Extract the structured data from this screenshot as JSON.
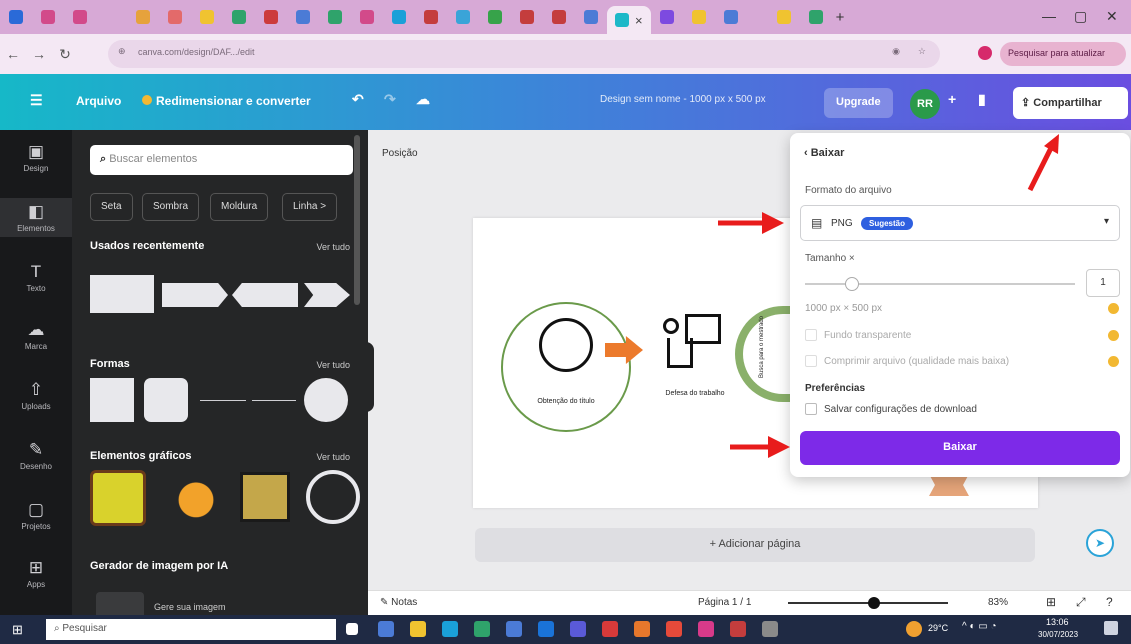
{
  "browser": {
    "url": "canva.com/design/DAF.../edit",
    "pause_button": "Pesquisar para atualizar",
    "close_tab": "×",
    "new_tab": "+"
  },
  "header": {
    "menu_icon": "☰",
    "file_label": "Arquivo",
    "resize_label": "Redimensionar e converter",
    "doc_title": "Design sem nome - 1000 px x 500 px",
    "upgrade_label": "Upgrade",
    "avatar_initials": "RR",
    "share_label": "Compartilhar"
  },
  "rail": {
    "items": [
      {
        "icon": "▣",
        "label": "Design"
      },
      {
        "icon": "◧",
        "label": "Elementos"
      },
      {
        "icon": "T",
        "label": "Texto"
      },
      {
        "icon": "☁",
        "label": "Marca"
      },
      {
        "icon": "⇧",
        "label": "Uploads"
      },
      {
        "icon": "✎",
        "label": "Desenho"
      },
      {
        "icon": "▢",
        "label": "Projetos"
      },
      {
        "icon": "⊞",
        "label": "Apps"
      }
    ]
  },
  "panel": {
    "search_placeholder": "Buscar elementos",
    "chips": [
      "Seta",
      "Sombra",
      "Moldura",
      "Linha >"
    ],
    "recent_title": "Usados recentemente",
    "shapes_title": "Formas",
    "graphics_title": "Elementos gráficos",
    "ai_title": "Gerador de imagem por IA",
    "ai_item": "Gere sua imagem",
    "see_all": "Ver tudo"
  },
  "canvas": {
    "position_label": "Posição",
    "node1_label": "Obtenção do título",
    "node2_label": "Defesa do trabalho",
    "node3_label": "Busca para o mestrado",
    "add_page_label": "+ Adicionar página",
    "notes_label": "Notas",
    "page_label": "Página 1 / 1",
    "zoom_label": "83%"
  },
  "download": {
    "back_label": "Baixar",
    "file_type_label": "Formato do arquivo",
    "format_value": "PNG",
    "format_badge": "Sugestão",
    "size_label": "Tamanho ×",
    "size_value": "1",
    "dims_label": "1000 px × 500 px",
    "opt_transparent": "Fundo transparente",
    "opt_compress": "Comprimir arquivo (qualidade mais baixa)",
    "prefs_label": "Preferências",
    "opt_save": "Salvar configurações de download",
    "download_button": "Baixar"
  },
  "taskbar": {
    "search_placeholder": "Pesquisar",
    "weather": "29°C",
    "time": "13:06",
    "date": "30/07/2023"
  },
  "colors": {
    "accent": "#7d2ae8",
    "arrow": "#e81c1c",
    "header_start": "#16b8c8",
    "header_end": "#6a4ee0"
  }
}
